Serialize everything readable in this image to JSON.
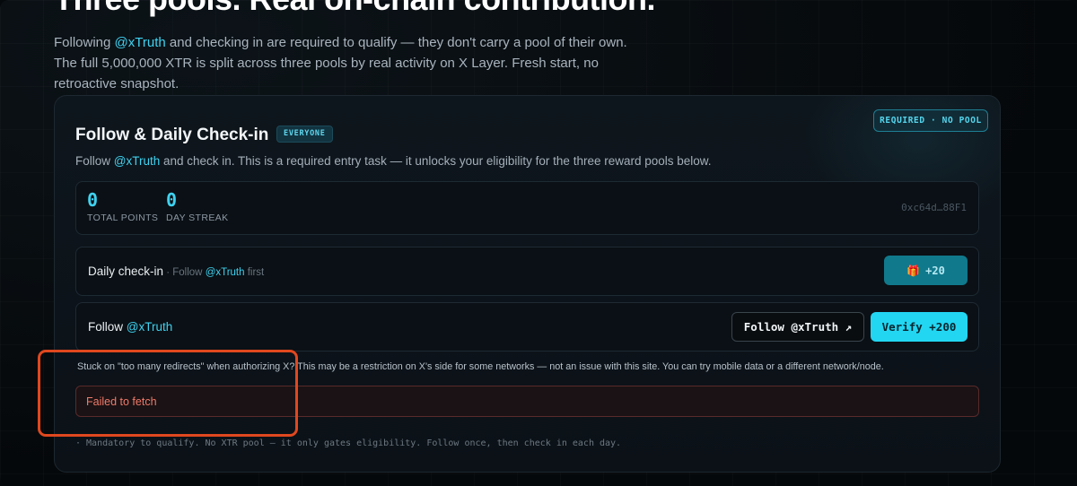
{
  "page": {
    "heading": "Three pools. Real on-chain contribution.",
    "intro": {
      "prefix": "Following ",
      "mention": "@xTruth",
      "suffix": " and checking in are required to qualify — they don't carry a pool of their own. The full 5,000,000 XTR is split across three pools by real activity on X Layer. Fresh start, no retroactive snapshot."
    }
  },
  "card": {
    "badge": "REQUIRED · NO POOL",
    "title": "Follow & Daily Check-in",
    "tag": "EVERYONE",
    "desc": {
      "prefix": "Follow ",
      "mention": "@xTruth",
      "suffix": " and check in. This is a required entry task — it unlocks your eligibility for the three reward pools below."
    },
    "stats": {
      "total_points_value": "0",
      "total_points_label": "TOTAL POINTS",
      "day_streak_value": "0",
      "day_streak_label": "DAY STREAK",
      "address": "0xc64d…88F1"
    },
    "checkin_row": {
      "title": "Daily check-in",
      "sub_prefix": " · Follow ",
      "sub_mention": "@xTruth",
      "sub_suffix": " first",
      "button_icon": "🎁",
      "button_label": "+20"
    },
    "follow_row": {
      "title_prefix": "Follow ",
      "title_mention": "@xTruth",
      "follow_button": "Follow @xTruth ↗",
      "verify_button": "Verify +200"
    },
    "warning": "Stuck on \"too many redirects\" when authorizing X? This may be a restriction on X's side for some networks — not an issue with this site. You can try mobile data or a different network/node.",
    "error": "Failed to fetch",
    "footnote": "· Mandatory to qualify. No XTR pool — it only gates eligibility. Follow once, then check in each day."
  },
  "colors": {
    "accent": "#22d6f2",
    "mention": "#3fd2f0",
    "error": "#f07a6a",
    "highlight": "#e0481f"
  }
}
